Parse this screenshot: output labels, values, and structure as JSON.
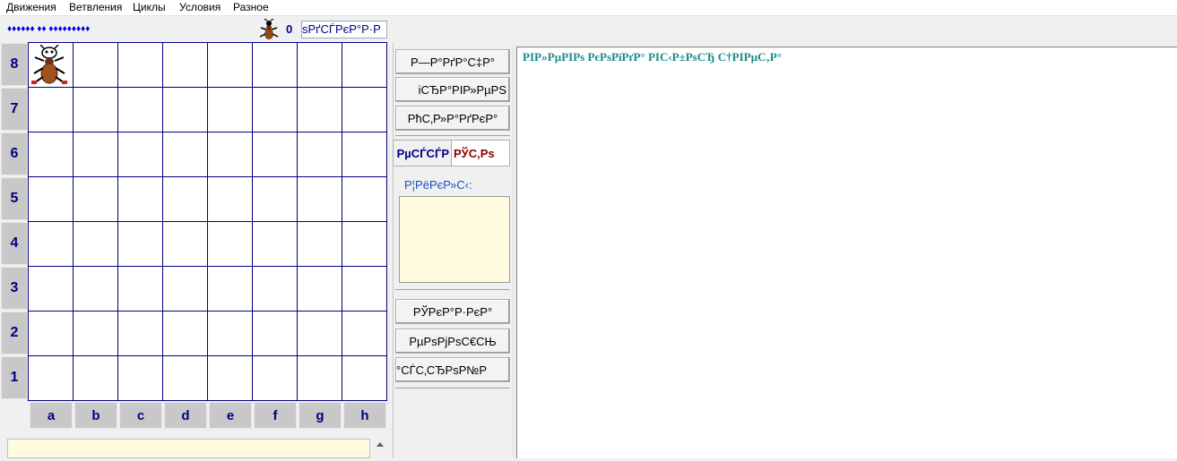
{
  "menu": {
    "items": [
      "Движения",
      "Ветвления",
      "Циклы",
      "Условия",
      "Разное"
    ]
  },
  "status": {
    "stars": "♦♦♦♦♦♦ ♦♦ ♦♦♦♦♦♦♦♦♦",
    "counter": "0",
    "mode_value": "sРґСЃРєР°Р·Р"
  },
  "board": {
    "ranks": [
      "8",
      "7",
      "6",
      "5",
      "4",
      "3",
      "2",
      "1"
    ],
    "files": [
      "a",
      "b",
      "c",
      "d",
      "e",
      "f",
      "g",
      "h"
    ],
    "ant_square": "a8"
  },
  "buttons": {
    "task": "Р—Р°РґР°С‡Р°",
    "control": "iСЂР°РІР»РµРЅ",
    "debug": "РћС‚Р»Р°РґРєР°",
    "hint": "РЎРєР°Р·РєР°",
    "economy": "РµРѕРјРѕС€СЊ",
    "settings": "°СЃС‚СЂРѕР№Р"
  },
  "tabs": {
    "left": "РµСЃСЃР",
    "right": "РЎС‚Рѕ"
  },
  "params": {
    "label": "Р¦РёРєР»С‹:"
  },
  "editor": {
    "text": "РІР»РµРІРѕ РєРѕРїРґР° РІС‹Р±РѕСЂ С†РІРµС‚Р°"
  },
  "colors": {
    "board_line": "#000080",
    "label_bg": "#c8c8c8",
    "editor_text": "#1a8a8a",
    "param_bg": "#fffce0"
  }
}
